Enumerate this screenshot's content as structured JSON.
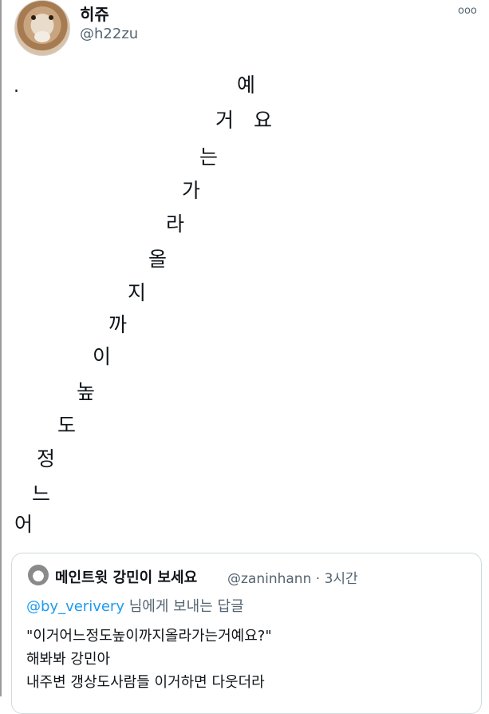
{
  "tweet": {
    "display_name": "히쥬",
    "handle": "@h22zu",
    "more_icon": "more-icon",
    "more_glyph": "ooo",
    "dot": ".",
    "chars": [
      "예",
      "거",
      "요",
      "는",
      "가",
      "라",
      "올",
      "지",
      "까",
      "이",
      "높",
      "도",
      "정",
      "느",
      "어"
    ]
  },
  "quote": {
    "display_name": "메인트윗 강민이 보세요",
    "handle_time": "@zaninhann · 3시간",
    "mention": "@by_verivery",
    "reply_suffix": " 님에게 보내는 답글",
    "line1": "\"이거어느정도높이까지올라가는거예요?\"",
    "line2": "해봐봐 강민아",
    "line3": "내주변 갱상도사람들 이거하면 다웃더라"
  }
}
